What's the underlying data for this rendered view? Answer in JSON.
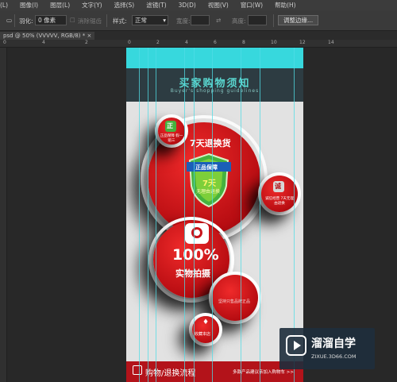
{
  "menu": [
    "(L)",
    "图像(I)",
    "图层(L)",
    "文字(Y)",
    "选择(S)",
    "滤镜(T)",
    "3D(D)",
    "视图(V)",
    "窗口(W)",
    "帮助(H)"
  ],
  "options": {
    "feather_label": "羽化:",
    "feather_value": "0 像素",
    "antialias_label": "消除锯齿",
    "style_label": "样式:",
    "style_value": "正常",
    "width_label": "宽度:",
    "height_label": "高度:",
    "refine_button": "调整边缘..."
  },
  "doc_tab": "psd @ 50% (VVVVV, RGB/8) * ×",
  "ruler_numbers": [
    "0",
    "4",
    "2",
    "0",
    "2",
    "4",
    "6",
    "8",
    "10",
    "12",
    "14"
  ],
  "design": {
    "header_title": "买家购物须知",
    "header_subtitle": "Buyer's shopping guidelines",
    "badge_zheng": "正",
    "circle1_text": "正品保障 假一赔三",
    "circle_main_title": "7天退换货",
    "shield_top": "正品保障",
    "shield_days": "7天",
    "shield_sub": "无理由退换",
    "badge_cheng": "诚",
    "circle_right_text": "诚信经营 7天无理由退换",
    "percent_number": "100%",
    "percent_label": "实物拍摄",
    "circle_small_text": "坚持只售品牌正品",
    "circle_bottom_text": "收藏本店",
    "footer_title": "购物/退换流程",
    "footer_note": "多款产品建议亲加入购物车 >>"
  },
  "watermark": {
    "brand": "溜溜自学",
    "url": "ZIXUE.3D66.COM"
  },
  "colors": {
    "accent_cyan": "#37d8dd",
    "brand_red": "#c8141b",
    "header_dark": "#2d3c42"
  }
}
